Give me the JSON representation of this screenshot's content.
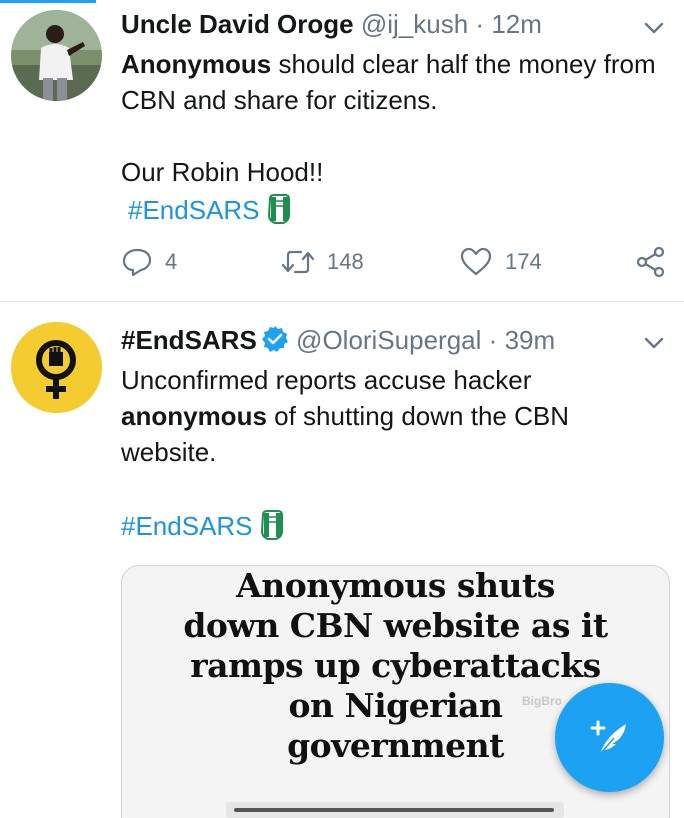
{
  "tweets": [
    {
      "name": "Uncle David Oroge",
      "handle": "@ij_kush",
      "separator": "·",
      "time": "12m",
      "text_bold": "Anonymous",
      "text_rest": " should clear half the money from CBN and share for citizens.",
      "text_line2": "Our Robin Hood!!",
      "hashtag": "#EndSARS",
      "replies": "4",
      "retweets": "148",
      "likes": "174"
    },
    {
      "name": "#EndSARS",
      "handle": "@OloriSupergal",
      "separator": "·",
      "time": "39m",
      "text_pre": "Unconfirmed reports accuse hacker ",
      "text_bold": "anonymous",
      "text_rest": " of shutting down the CBN website.",
      "hashtag": "#EndSARS",
      "card": {
        "headline_lines": [
          "Anonymous shuts",
          "down CBN website as it",
          "ramps up cyberattacks",
          "on Nigerian",
          "government"
        ],
        "watermark": "BigBro"
      }
    }
  ],
  "colors": {
    "accent": "#1da1f2",
    "hashtag": "#1b95e0",
    "muted": "#657786",
    "verified": "#1da1f2",
    "avatar2_bg": "#f5cc2f",
    "fist_green": "#1e8f4e"
  },
  "icons": [
    "caret-down-icon",
    "reply-icon",
    "retweet-icon",
    "like-icon",
    "share-icon",
    "verified-badge-icon",
    "fist-emoji-icon",
    "compose-tweet-icon"
  ]
}
